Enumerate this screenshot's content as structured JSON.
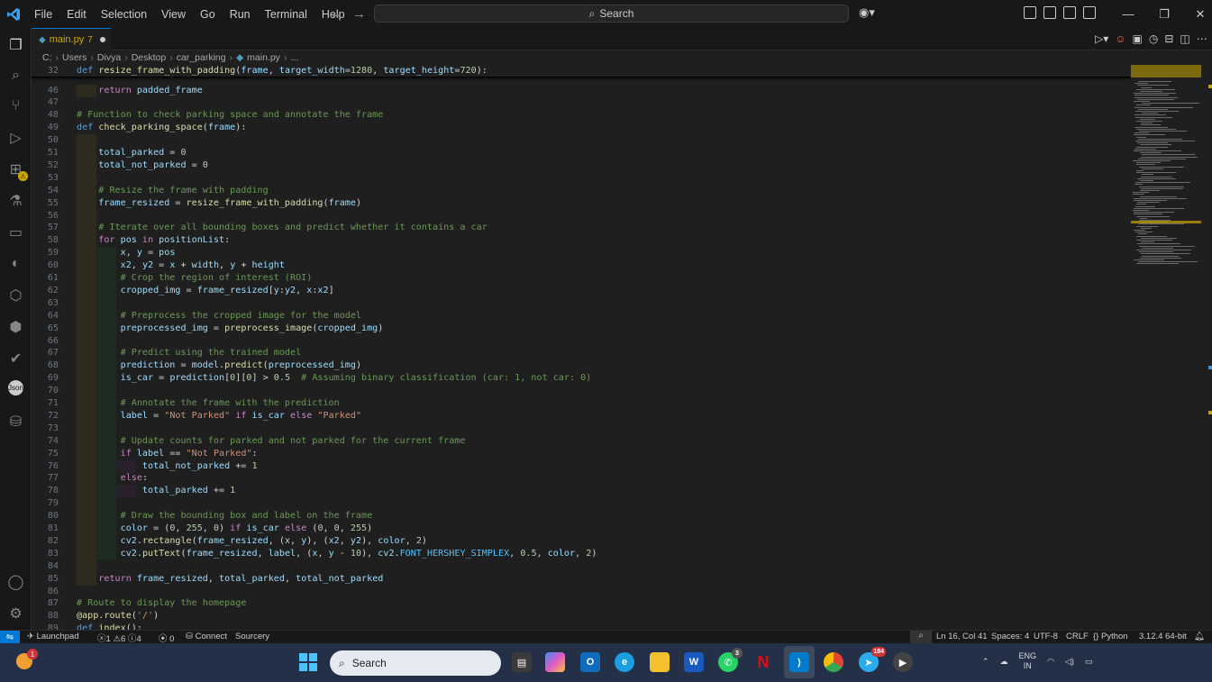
{
  "titlebar": {
    "menu": [
      "File",
      "Edit",
      "Selection",
      "View",
      "Go",
      "Run",
      "Terminal",
      "Help"
    ],
    "search_label": "Search"
  },
  "tab": {
    "name": "main.py",
    "problems": "7"
  },
  "breadcrumb": [
    "C:",
    "Users",
    "Divya",
    "Desktop",
    "car_parking",
    "main.py",
    "..."
  ],
  "editor": {
    "sticky": {
      "ln": "32",
      "code": [
        [
          "kd",
          "def "
        ],
        [
          "f",
          "resize_frame_with_padding"
        ],
        [
          "t",
          "("
        ],
        [
          "v",
          "frame"
        ],
        [
          "t",
          ", "
        ],
        [
          "v",
          "target_width"
        ],
        [
          "t",
          "="
        ],
        [
          "n",
          "1280"
        ],
        [
          "t",
          ", "
        ],
        [
          "v",
          "target_height"
        ],
        [
          "t",
          "="
        ],
        [
          "n",
          "720"
        ],
        [
          "t",
          "):"
        ]
      ]
    },
    "lines": [
      {
        "ln": "46",
        "ind": 1,
        "code": [
          [
            "k",
            "    return "
          ],
          [
            "v",
            "padded_frame"
          ]
        ]
      },
      {
        "ln": "47",
        "ind": 0,
        "code": []
      },
      {
        "ln": "48",
        "ind": 0,
        "code": [
          [
            "c",
            "# Function to check parking space and annotate the frame"
          ]
        ]
      },
      {
        "ln": "49",
        "ind": 0,
        "code": [
          [
            "kd",
            "def "
          ],
          [
            "f",
            "check_parking_space"
          ],
          [
            "t",
            "("
          ],
          [
            "v",
            "frame"
          ],
          [
            "t",
            "):"
          ]
        ]
      },
      {
        "ln": "50",
        "ind": 1,
        "code": []
      },
      {
        "ln": "51",
        "ind": 1,
        "code": [
          [
            "v",
            "    total_parked"
          ],
          [
            "t",
            " = "
          ],
          [
            "n",
            "0"
          ]
        ]
      },
      {
        "ln": "52",
        "ind": 1,
        "code": [
          [
            "v",
            "    total_not_parked"
          ],
          [
            "t",
            " = "
          ],
          [
            "n",
            "0"
          ]
        ]
      },
      {
        "ln": "53",
        "ind": 1,
        "code": []
      },
      {
        "ln": "54",
        "ind": 1,
        "code": [
          [
            "c",
            "    # Resize the frame with padding"
          ]
        ]
      },
      {
        "ln": "55",
        "ind": 1,
        "code": [
          [
            "v",
            "    frame_resized"
          ],
          [
            "t",
            " = "
          ],
          [
            "f",
            "resize_frame_with_padding"
          ],
          [
            "t",
            "("
          ],
          [
            "v",
            "frame"
          ],
          [
            "t",
            ")"
          ]
        ]
      },
      {
        "ln": "56",
        "ind": 1,
        "code": []
      },
      {
        "ln": "57",
        "ind": 1,
        "code": [
          [
            "c",
            "    # Iterate over all bounding boxes and predict whether it contains a car"
          ]
        ]
      },
      {
        "ln": "58",
        "ind": 1,
        "code": [
          [
            "k",
            "    for "
          ],
          [
            "v",
            "pos"
          ],
          [
            "k",
            " in "
          ],
          [
            "v",
            "positionList"
          ],
          [
            "t",
            ":"
          ]
        ]
      },
      {
        "ln": "59",
        "ind": 2,
        "code": [
          [
            "v",
            "        x"
          ],
          [
            "t",
            ", "
          ],
          [
            "v",
            "y"
          ],
          [
            "t",
            " = "
          ],
          [
            "v",
            "pos"
          ]
        ]
      },
      {
        "ln": "60",
        "ind": 2,
        "code": [
          [
            "v",
            "        x2"
          ],
          [
            "t",
            ", "
          ],
          [
            "v",
            "y2"
          ],
          [
            "t",
            " = "
          ],
          [
            "v",
            "x"
          ],
          [
            "t",
            " + "
          ],
          [
            "v",
            "width"
          ],
          [
            "t",
            ", "
          ],
          [
            "v",
            "y"
          ],
          [
            "t",
            " + "
          ],
          [
            "v",
            "height"
          ]
        ]
      },
      {
        "ln": "61",
        "ind": 2,
        "code": [
          [
            "c",
            "        # Crop the region of interest (ROI)"
          ]
        ]
      },
      {
        "ln": "62",
        "ind": 2,
        "code": [
          [
            "v",
            "        cropped_img"
          ],
          [
            "t",
            " = "
          ],
          [
            "v",
            "frame_resized"
          ],
          [
            "t",
            "["
          ],
          [
            "v",
            "y"
          ],
          [
            "t",
            ":"
          ],
          [
            "v",
            "y2"
          ],
          [
            "t",
            ", "
          ],
          [
            "v",
            "x"
          ],
          [
            "t",
            ":"
          ],
          [
            "v",
            "x2"
          ],
          [
            "t",
            "]"
          ]
        ]
      },
      {
        "ln": "63",
        "ind": 2,
        "code": []
      },
      {
        "ln": "64",
        "ind": 2,
        "code": [
          [
            "c",
            "        # Preprocess the cropped image for the model"
          ]
        ]
      },
      {
        "ln": "65",
        "ind": 2,
        "code": [
          [
            "v",
            "        preprocessed_img"
          ],
          [
            "t",
            " = "
          ],
          [
            "f",
            "preprocess_image"
          ],
          [
            "t",
            "("
          ],
          [
            "v",
            "cropped_img"
          ],
          [
            "t",
            ")"
          ]
        ]
      },
      {
        "ln": "66",
        "ind": 2,
        "code": []
      },
      {
        "ln": "67",
        "ind": 2,
        "code": [
          [
            "c",
            "        # Predict using the trained model"
          ]
        ]
      },
      {
        "ln": "68",
        "ind": 2,
        "code": [
          [
            "v",
            "        prediction"
          ],
          [
            "t",
            " = "
          ],
          [
            "v",
            "model"
          ],
          [
            "t",
            "."
          ],
          [
            "f",
            "predict"
          ],
          [
            "t",
            "("
          ],
          [
            "v",
            "preprocessed_img"
          ],
          [
            "t",
            ")"
          ]
        ]
      },
      {
        "ln": "69",
        "ind": 2,
        "code": [
          [
            "v",
            "        is_car"
          ],
          [
            "t",
            " = "
          ],
          [
            "v",
            "prediction"
          ],
          [
            "t",
            "["
          ],
          [
            "n",
            "0"
          ],
          [
            "t",
            "]["
          ],
          [
            "n",
            "0"
          ],
          [
            "t",
            "] > "
          ],
          [
            "n",
            "0.5"
          ],
          [
            "c",
            "  # Assuming binary classification (car: 1, not car: 0)"
          ]
        ]
      },
      {
        "ln": "70",
        "ind": 2,
        "code": []
      },
      {
        "ln": "71",
        "ind": 2,
        "code": [
          [
            "c",
            "        # Annotate the frame with the prediction"
          ]
        ]
      },
      {
        "ln": "72",
        "ind": 2,
        "code": [
          [
            "v",
            "        label"
          ],
          [
            "t",
            " = "
          ],
          [
            "s",
            "\"Not Parked\""
          ],
          [
            "k",
            " if "
          ],
          [
            "v",
            "is_car"
          ],
          [
            "k",
            " else "
          ],
          [
            "s",
            "\"Parked\""
          ]
        ]
      },
      {
        "ln": "73",
        "ind": 2,
        "code": []
      },
      {
        "ln": "74",
        "ind": 2,
        "code": [
          [
            "c",
            "        # Update counts for parked and not parked for the current frame"
          ]
        ]
      },
      {
        "ln": "75",
        "ind": 2,
        "code": [
          [
            "k",
            "        if "
          ],
          [
            "v",
            "label"
          ],
          [
            "t",
            " == "
          ],
          [
            "s",
            "\"Not Parked\""
          ],
          [
            "t",
            ":"
          ]
        ]
      },
      {
        "ln": "76",
        "ind": 3,
        "code": [
          [
            "v",
            "            total_not_parked"
          ],
          [
            "t",
            " += "
          ],
          [
            "n",
            "1"
          ]
        ]
      },
      {
        "ln": "77",
        "ind": 2,
        "code": [
          [
            "k",
            "        else"
          ],
          [
            "t",
            ":"
          ]
        ]
      },
      {
        "ln": "78",
        "ind": 3,
        "code": [
          [
            "v",
            "            total_parked"
          ],
          [
            "t",
            " += "
          ],
          [
            "n",
            "1"
          ]
        ]
      },
      {
        "ln": "79",
        "ind": 2,
        "code": []
      },
      {
        "ln": "80",
        "ind": 2,
        "code": [
          [
            "c",
            "        # Draw the bounding box and label on the frame"
          ]
        ]
      },
      {
        "ln": "81",
        "ind": 2,
        "code": [
          [
            "v",
            "        color"
          ],
          [
            "t",
            " = ("
          ],
          [
            "n",
            "0"
          ],
          [
            "t",
            ", "
          ],
          [
            "n",
            "255"
          ],
          [
            "t",
            ", "
          ],
          [
            "n",
            "0"
          ],
          [
            "t",
            ")"
          ],
          [
            "k",
            " if "
          ],
          [
            "v",
            "is_car"
          ],
          [
            "k",
            " else "
          ],
          [
            "t",
            "("
          ],
          [
            "n",
            "0"
          ],
          [
            "t",
            ", "
          ],
          [
            "n",
            "0"
          ],
          [
            "t",
            ", "
          ],
          [
            "n",
            "255"
          ],
          [
            "t",
            ")"
          ]
        ]
      },
      {
        "ln": "82",
        "ind": 2,
        "code": [
          [
            "v",
            "        cv2"
          ],
          [
            "t",
            "."
          ],
          [
            "f",
            "rectangle"
          ],
          [
            "t",
            "("
          ],
          [
            "v",
            "frame_resized"
          ],
          [
            "t",
            ", ("
          ],
          [
            "v",
            "x"
          ],
          [
            "t",
            ", "
          ],
          [
            "v",
            "y"
          ],
          [
            "t",
            "), ("
          ],
          [
            "v",
            "x2"
          ],
          [
            "t",
            ", "
          ],
          [
            "v",
            "y2"
          ],
          [
            "t",
            "), "
          ],
          [
            "v",
            "color"
          ],
          [
            "t",
            ", "
          ],
          [
            "n",
            "2"
          ],
          [
            "t",
            ")"
          ]
        ]
      },
      {
        "ln": "83",
        "ind": 2,
        "code": [
          [
            "v",
            "        cv2"
          ],
          [
            "t",
            "."
          ],
          [
            "f",
            "putText"
          ],
          [
            "t",
            "("
          ],
          [
            "v",
            "frame_resized"
          ],
          [
            "t",
            ", "
          ],
          [
            "v",
            "label"
          ],
          [
            "t",
            ", ("
          ],
          [
            "v",
            "x"
          ],
          [
            "t",
            ", "
          ],
          [
            "v",
            "y"
          ],
          [
            "t",
            " - "
          ],
          [
            "n",
            "10"
          ],
          [
            "t",
            "), "
          ],
          [
            "v",
            "cv2"
          ],
          [
            "t",
            "."
          ],
          [
            "co",
            "FONT_HERSHEY_SIMPLEX"
          ],
          [
            "t",
            ", "
          ],
          [
            "n",
            "0.5"
          ],
          [
            "t",
            ", "
          ],
          [
            "v",
            "color"
          ],
          [
            "t",
            ", "
          ],
          [
            "n",
            "2"
          ],
          [
            "t",
            ")"
          ]
        ]
      },
      {
        "ln": "84",
        "ind": 1,
        "code": []
      },
      {
        "ln": "85",
        "ind": 1,
        "code": [
          [
            "k",
            "    return "
          ],
          [
            "v",
            "frame_resized"
          ],
          [
            "t",
            ", "
          ],
          [
            "v",
            "total_parked"
          ],
          [
            "t",
            ", "
          ],
          [
            "v",
            "total_not_parked"
          ]
        ]
      },
      {
        "ln": "86",
        "ind": 0,
        "code": []
      },
      {
        "ln": "87",
        "ind": 0,
        "code": [
          [
            "c",
            "# Route to display the homepage"
          ]
        ]
      },
      {
        "ln": "88",
        "ind": 0,
        "code": [
          [
            "f",
            "@app.route"
          ],
          [
            "t",
            "("
          ],
          [
            "s",
            "'/'"
          ],
          [
            "t",
            ")"
          ]
        ]
      },
      {
        "ln": "89",
        "ind": 0,
        "code": [
          [
            "kd",
            "def "
          ],
          [
            "f",
            "index"
          ],
          [
            "t",
            "():"
          ]
        ]
      }
    ]
  },
  "statusbar": {
    "launchpad": "Launchpad",
    "errors": "1",
    "warnings": "6",
    "infos": "4",
    "ports": "0",
    "connect": "Connect",
    "sourcery": "Sourcery",
    "position": "Ln 16, Col 41",
    "spaces": "Spaces: 4",
    "encoding": "UTF-8",
    "eol": "CRLF",
    "language": "Python",
    "interpreter": "3.12.4 64-bit"
  },
  "taskbar": {
    "weather_badge": "1",
    "search_label": "Search",
    "whatsapp_badge": "3",
    "telegram_badge": "184",
    "lang": "ENG",
    "region": "IN"
  },
  "colors": {
    "accent": "#0078d4",
    "warning": "#cca700",
    "editor_bg": "#1f1f1f"
  }
}
